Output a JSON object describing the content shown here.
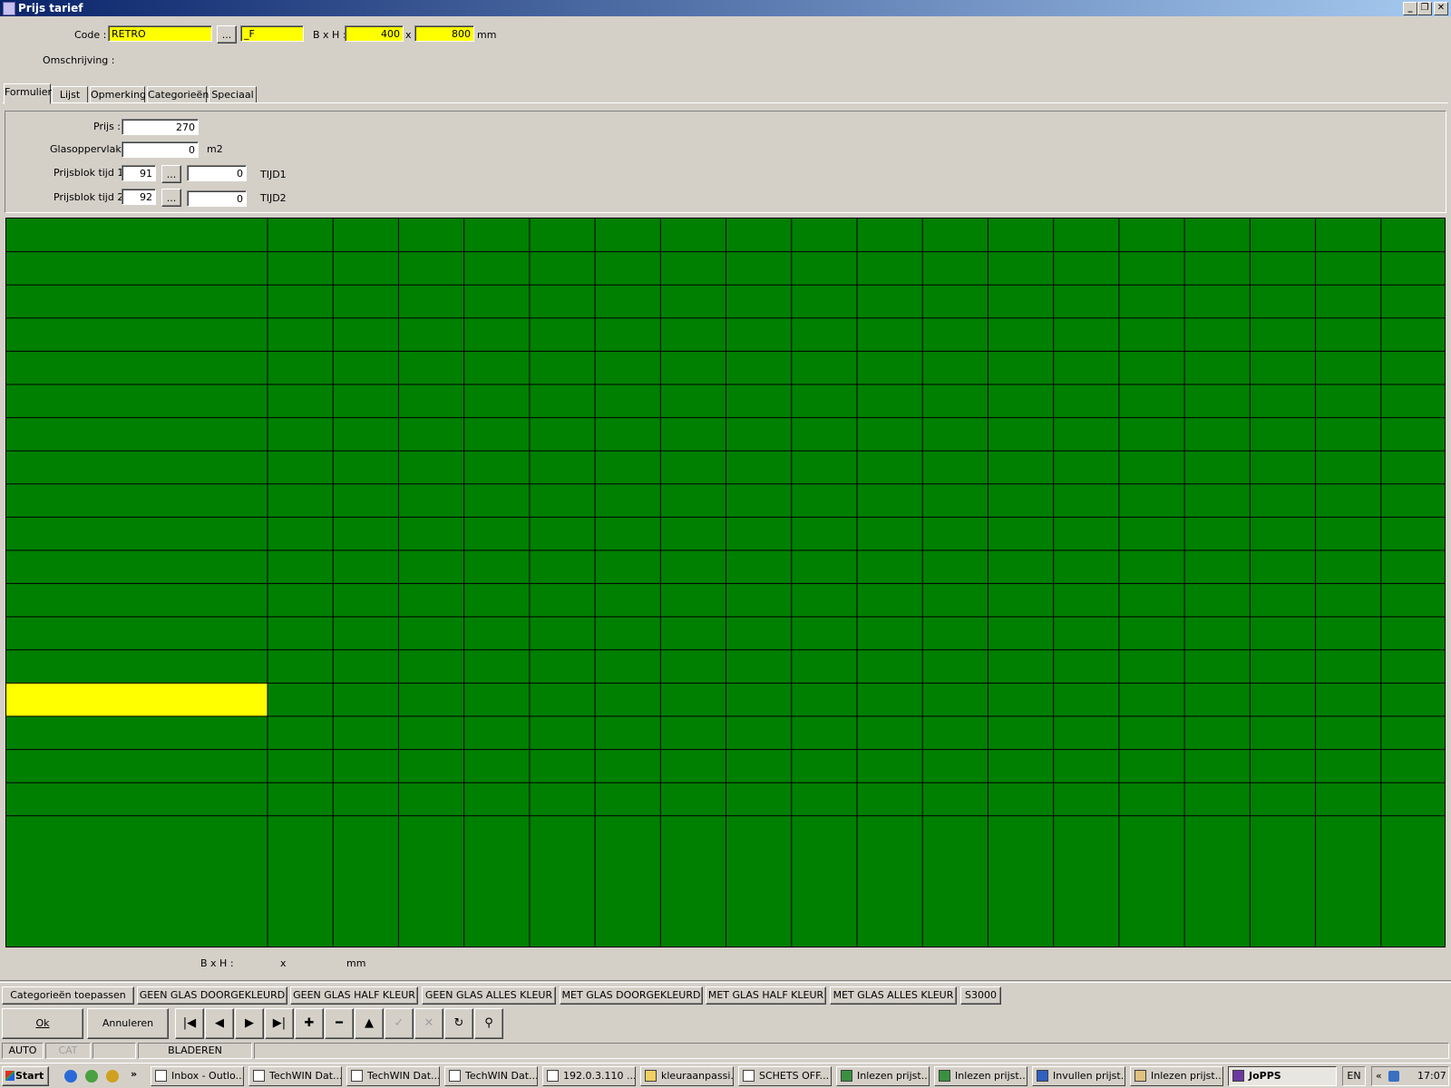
{
  "window": {
    "title": "Prijs tarief",
    "minimize": "_",
    "restore": "❐",
    "close": "✕"
  },
  "header": {
    "code_label": "Code :",
    "code_value": "RETRO",
    "code_browse": "...",
    "code_suffix": "_F",
    "bxh_label": "B x H :",
    "width": "400",
    "times": "x",
    "height": "800",
    "unit": "mm",
    "omschrijving_label": "Omschrijving :"
  },
  "tabs": [
    {
      "label": "Formulier",
      "active": true
    },
    {
      "label": "Lijst"
    },
    {
      "label": "Opmerking"
    },
    {
      "label": "Categorieën"
    },
    {
      "label": "Speciaal"
    }
  ],
  "form": {
    "prijs_label": "Prijs :",
    "prijs_value": "270",
    "glas_label": "Glasoppervlak :",
    "glas_value": "0",
    "glas_unit": "m2",
    "blok1_label": "Prijsblok tijd 1 :",
    "blok1_code": "91",
    "blok1_browse": "...",
    "blok1_value": "0",
    "blok1_name": "TIJD1",
    "blok2_label": "Prijsblok tijd 2 :",
    "blok2_code": "92",
    "blok2_browse": "...",
    "blok2_value": "0",
    "blok2_name": "TIJD2"
  },
  "grid": {
    "rows": 18,
    "data_columns": 18,
    "selected_row": 14,
    "cell_color": "#008000",
    "selected_color": "#ffff00"
  },
  "footer_bxh": {
    "label": "B x H :",
    "times": "x",
    "unit": "mm"
  },
  "category_buttons": [
    "Categorieën toepassen",
    "GEEN GLAS DOORGEKLEURD",
    "GEEN GLAS HALF KLEUR",
    "GEEN GLAS ALLES KLEUR",
    "MET GLAS DOORGEKLEURD",
    "MET GLAS HALF KLEUR",
    "MET GLAS ALLES KLEUR",
    "S3000"
  ],
  "actions": {
    "ok": "Ok",
    "cancel": "Annuleren"
  },
  "nav_buttons": [
    {
      "name": "first-record-icon",
      "glyph": "|◀"
    },
    {
      "name": "previous-record-icon",
      "glyph": "◀"
    },
    {
      "name": "next-record-icon",
      "glyph": "▶"
    },
    {
      "name": "last-record-icon",
      "glyph": "▶|"
    },
    {
      "name": "add-record-icon",
      "glyph": "✚"
    },
    {
      "name": "delete-record-icon",
      "glyph": "━"
    },
    {
      "name": "edit-record-icon",
      "glyph": "▲"
    },
    {
      "name": "post-record-icon",
      "glyph": "✓",
      "disabled": true
    },
    {
      "name": "cancel-edit-icon",
      "glyph": "✕",
      "disabled": true
    },
    {
      "name": "refresh-icon",
      "glyph": "↻"
    },
    {
      "name": "find-binoculars-icon",
      "glyph": "⚲"
    }
  ],
  "status": {
    "mode1": "AUTO",
    "mode2": "CAT",
    "mode3": "",
    "state": "BLADEREN"
  },
  "taskbar": {
    "start": "Start",
    "quick_more": "»",
    "tasks": [
      "Inbox - Outlo...",
      "TechWIN Dat...",
      "TechWIN Dat...",
      "TechWIN Dat...",
      "192.0.3.110 ...",
      "kleuraanpassi...",
      "SCHETS OFF...",
      "Inlezen prijst...",
      "Inlezen prijst...",
      "Invullen prijst...",
      "Inlezen prijst...",
      "JoPPS"
    ],
    "active_task": 11,
    "lang": "EN",
    "tray_more": "«",
    "clock": "17:07"
  }
}
